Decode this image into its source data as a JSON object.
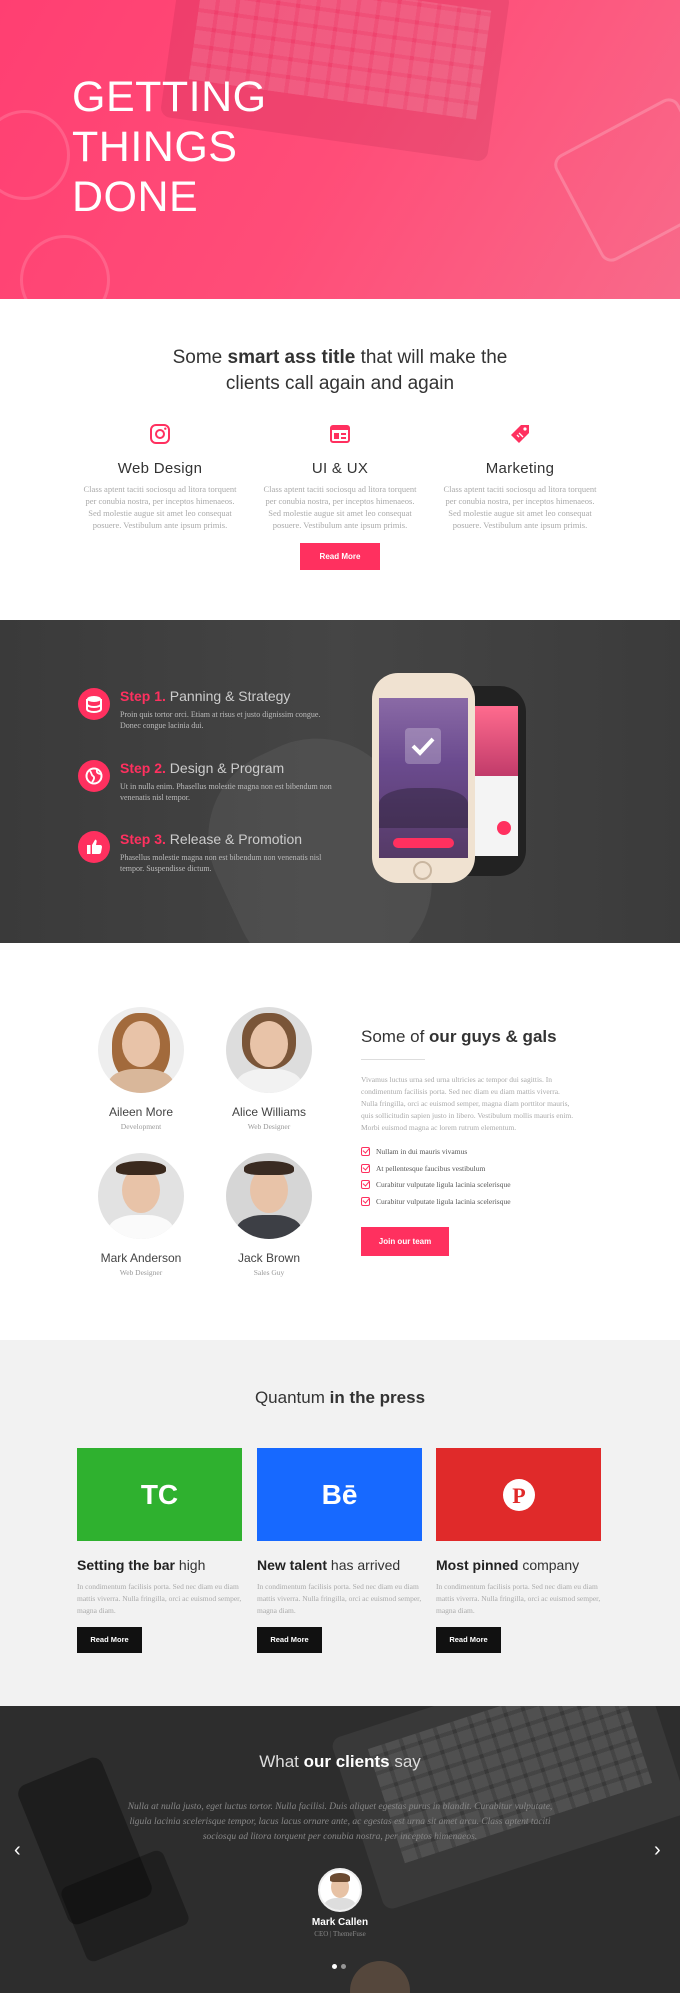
{
  "hero": {
    "title_lines": [
      "GETTING",
      "THINGS",
      "DONE"
    ]
  },
  "services": {
    "title_pre": "Some ",
    "title_bold": "smart ass title",
    "title_post": " that will make the",
    "title_line2": "clients call again and again",
    "items": [
      {
        "icon": "instagram-icon",
        "title": "Web Design",
        "text": "Class aptent taciti sociosqu ad litora torquent per conubia nostra, per inceptos himenaeos. Sed molestie augue sit amet leo consequat posuere. Vestibulum ante ipsum primis."
      },
      {
        "icon": "browser-icon",
        "title": "UI & UX",
        "text": "Class aptent taciti sociosqu ad litora torquent per conubia nostra, per inceptos himenaeos. Sed molestie augue sit amet leo consequat posuere. Vestibulum ante ipsum primis."
      },
      {
        "icon": "tag-icon",
        "title": "Marketing",
        "text": "Class aptent taciti sociosqu ad litora torquent per conubia nostra, per inceptos himenaeos. Sed molestie augue sit amet leo consequat posuere. Vestibulum ante ipsum primis."
      }
    ],
    "button": "Read More"
  },
  "steps": {
    "items": [
      {
        "icon": "database-icon",
        "num": "Step 1.",
        "title": "Panning & Strategy",
        "text": "Proin quis tortor orci. Etiam at risus et justo dignissim congue. Donec congue lacinia dui."
      },
      {
        "icon": "globe-icon",
        "num": "Step 2.",
        "title": "Design & Program",
        "text": "Ut in nulla enim. Phasellus molestie magna non est bibendum non venenatis nisl tempor."
      },
      {
        "icon": "thumbs-up-icon",
        "num": "Step 3.",
        "title": "Release & Promotion",
        "text": "Phasellus molestie magna non est bibendum non venenatis nisl tempor. Suspendisse dictum."
      }
    ]
  },
  "team": {
    "title_pre": "Some of ",
    "title_bold": "our guys & gals",
    "description": "Vivamus luctus urna sed urna ultricies ac tempor dui sagittis. In condimentum facilisis porta. Sed nec diam eu diam mattis viverra. Nulla fringilla, orci ac euismod semper, magna diam porttitor mauris, quis sollicitudin sapien justo in libero. Vestibulum mollis mauris enim. Morbi euismod magna ac lorem rutrum elementum.",
    "checks": [
      "Nullam in dui mauris vivamus",
      "At pellentesque faucibus vestibulum",
      "Curabitur vulputate ligula lacinia scelerisque",
      "Curabitur vulputate ligula lacinia scelerisque"
    ],
    "button": "Join our team",
    "members": [
      {
        "name": "Aileen More",
        "role": "Development"
      },
      {
        "name": "Alice Williams",
        "role": "Web Designer"
      },
      {
        "name": "Mark Anderson",
        "role": "Web Designer"
      },
      {
        "name": "Jack Brown",
        "role": "Sales Guy"
      }
    ]
  },
  "press": {
    "title_pre": "Quantum ",
    "title_bold": "in the press",
    "cards": [
      {
        "logo": "TC",
        "bold": "Setting the bar",
        "rest": " high",
        "color": "#2fb12f",
        "text": "In condimentum facilisis porta. Sed nec diam eu diam mattis viverra. Nulla fringilla, orci ac euismod semper, magna diam.",
        "button": "Read More"
      },
      {
        "logo": "Bē",
        "bold": "New talent",
        "rest": " has arrived",
        "color": "#1769ff",
        "text": "In condimentum facilisis porta. Sed nec diam eu diam mattis viverra. Nulla fringilla, orci ac euismod semper, magna diam.",
        "button": "Read More"
      },
      {
        "logo": "P",
        "bold": "Most pinned",
        "rest": " company",
        "color": "#e02a2a",
        "text": "In condimentum facilisis porta. Sed nec diam eu diam mattis viverra. Nulla fringilla, orci ac euismod semper, magna diam.",
        "button": "Read More"
      }
    ]
  },
  "testimonial": {
    "title_pre": "What ",
    "title_bold": "our clients",
    "title_post": " say",
    "quote": "Nulla at nulla justo, eget luctus tortor. Nulla facilisi. Duis aliquet egestas purus in blandit. Curabitur vulputate, ligula lacinia scelerisque tempor, lacus lacus ornare ante, ac egestas est urna sit amet arcu. Class aptent taciti sociosqu ad litora torquent per conubia nostra, per inceptos himenaeos.",
    "name": "Mark Callen",
    "role": "CEO | ThemeFuse",
    "prev": "‹",
    "next": "›"
  },
  "colors": {
    "accent": "#ff305f",
    "dark": "#111111"
  }
}
